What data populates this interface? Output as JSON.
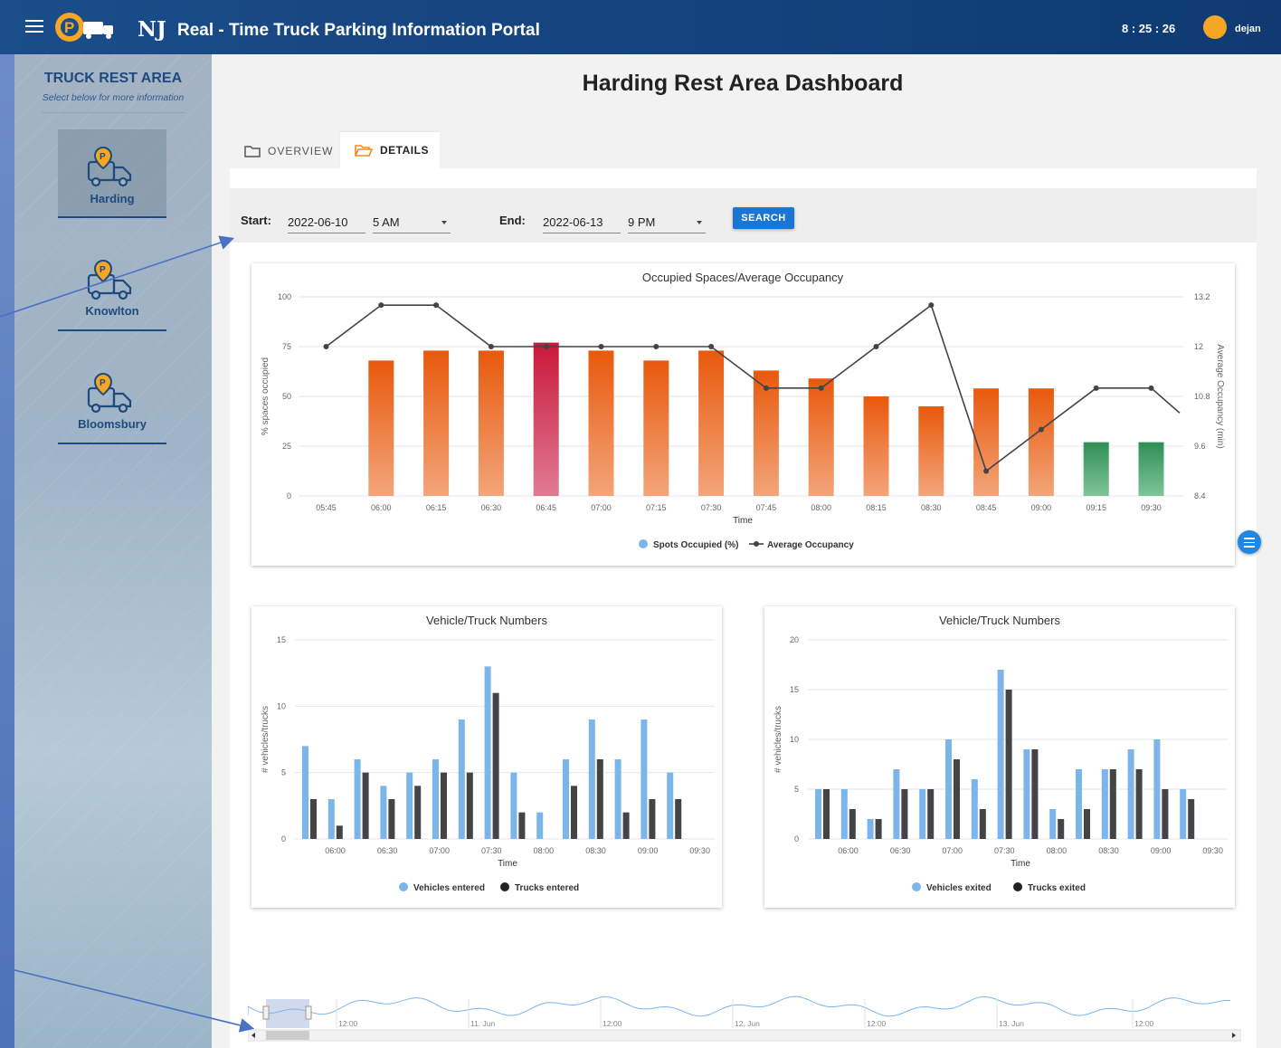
{
  "header": {
    "brand": "NJ",
    "title": "Real - Time Truck Parking Information Portal",
    "clock": "8 : 25 : 26",
    "user": "dejan"
  },
  "sidebar": {
    "title": "TRUCK REST AREA",
    "subtitle": "Select below for more information",
    "items": [
      {
        "label": "Harding",
        "active": true
      },
      {
        "label": "Knowlton",
        "active": false
      },
      {
        "label": "Bloomsbury",
        "active": false
      }
    ]
  },
  "page": {
    "title": "Harding Rest Area Dashboard",
    "tabs": [
      {
        "label": "OVERVIEW",
        "active": false
      },
      {
        "label": "DETAILS",
        "active": true
      }
    ]
  },
  "filters": {
    "start_label": "Start:",
    "start_date": "2022-06-10",
    "start_hour": "5 AM",
    "end_label": "End:",
    "end_date": "2022-06-13",
    "end_hour": "9 PM",
    "search_label": "SEARCH"
  },
  "colors": {
    "header": "#0f3a72",
    "bar_orange": "#e8590c",
    "bar_red": "#c9183a",
    "bar_green": "#2f8f55",
    "vehicles": "#7cb5ec",
    "trucks": "#434348",
    "line": "#434348"
  },
  "chart_data": [
    {
      "type": "bar",
      "title": "Occupied Spaces/Average Occupancy",
      "xlabel": "Time",
      "ylabel": "% spaces occupied",
      "y2label": "Average Occupancy (min)",
      "categories": [
        "05:45",
        "06:00",
        "06:15",
        "06:30",
        "06:45",
        "07:00",
        "07:15",
        "07:30",
        "07:45",
        "08:00",
        "08:15",
        "08:30",
        "08:45",
        "09:00",
        "09:15",
        "09:30"
      ],
      "ylim": [
        0,
        100
      ],
      "yticks": [
        0,
        25,
        50,
        75,
        100
      ],
      "y2lim": [
        8.4,
        13.2
      ],
      "y2ticks": [
        8.4,
        9.6,
        10.8,
        12,
        13.2
      ],
      "series": [
        {
          "name": "Spots Occupied (%)",
          "axis": "left",
          "values": [
            0,
            68,
            73,
            73,
            77,
            73,
            68,
            73,
            63,
            59,
            50,
            45,
            54,
            54,
            27,
            27
          ]
        },
        {
          "name": "Average Occupancy",
          "axis": "right",
          "type": "line",
          "values": [
            12.0,
            13.0,
            13.0,
            12.0,
            12.0,
            12.0,
            12.0,
            12.0,
            11.0,
            11.0,
            12.0,
            13.0,
            9.0,
            10.0,
            11.0,
            11.0
          ]
        }
      ],
      "legend": "bottom-center"
    },
    {
      "type": "bar",
      "title": "Vehicle/Truck Numbers",
      "xlabel": "Time",
      "ylabel": "# vehicles/trucks",
      "categories": [
        "05:45",
        "06:00",
        "06:15",
        "06:30",
        "06:45",
        "07:00",
        "07:15",
        "07:30",
        "07:45",
        "08:00",
        "08:15",
        "08:30",
        "08:45",
        "09:00",
        "09:15",
        "09:30"
      ],
      "xticks": [
        "06:00",
        "06:30",
        "07:00",
        "07:30",
        "08:00",
        "08:30",
        "09:00",
        "09:30"
      ],
      "ylim": [
        0,
        15
      ],
      "yticks": [
        0,
        5,
        10,
        15
      ],
      "series": [
        {
          "name": "Vehicles entered",
          "values": [
            7,
            3,
            6,
            4,
            5,
            6,
            9,
            13,
            5,
            2,
            6,
            9,
            6,
            9,
            5
          ]
        },
        {
          "name": "Trucks entered",
          "values": [
            3,
            1,
            5,
            3,
            4,
            5,
            5,
            11,
            2,
            0,
            4,
            6,
            2,
            3,
            3
          ]
        }
      ],
      "legend": "bottom-center"
    },
    {
      "type": "bar",
      "title": "Vehicle/Truck Numbers",
      "xlabel": "Time",
      "ylabel": "# vehicles/trucks",
      "categories": [
        "05:45",
        "06:00",
        "06:15",
        "06:30",
        "06:45",
        "07:00",
        "07:15",
        "07:30",
        "07:45",
        "08:00",
        "08:15",
        "08:30",
        "08:45",
        "09:00",
        "09:15",
        "09:30"
      ],
      "xticks": [
        "06:00",
        "06:30",
        "07:00",
        "07:30",
        "08:00",
        "08:30",
        "09:00",
        "09:30"
      ],
      "ylim": [
        0,
        20
      ],
      "yticks": [
        0,
        5,
        10,
        15,
        20
      ],
      "series": [
        {
          "name": "Vehicles exited",
          "values": [
            5,
            5,
            2,
            7,
            5,
            10,
            6,
            17,
            9,
            3,
            7,
            7,
            9,
            10,
            5
          ]
        },
        {
          "name": "Trucks exited",
          "values": [
            5,
            3,
            2,
            5,
            5,
            8,
            3,
            15,
            9,
            2,
            3,
            7,
            7,
            5,
            4
          ]
        }
      ],
      "legend": "bottom-center"
    }
  ],
  "navigator": {
    "labels": [
      "12:00",
      "11. Jun",
      "12:00",
      "12. Jun",
      "12:00",
      "13. Jun",
      "12:00"
    ]
  }
}
